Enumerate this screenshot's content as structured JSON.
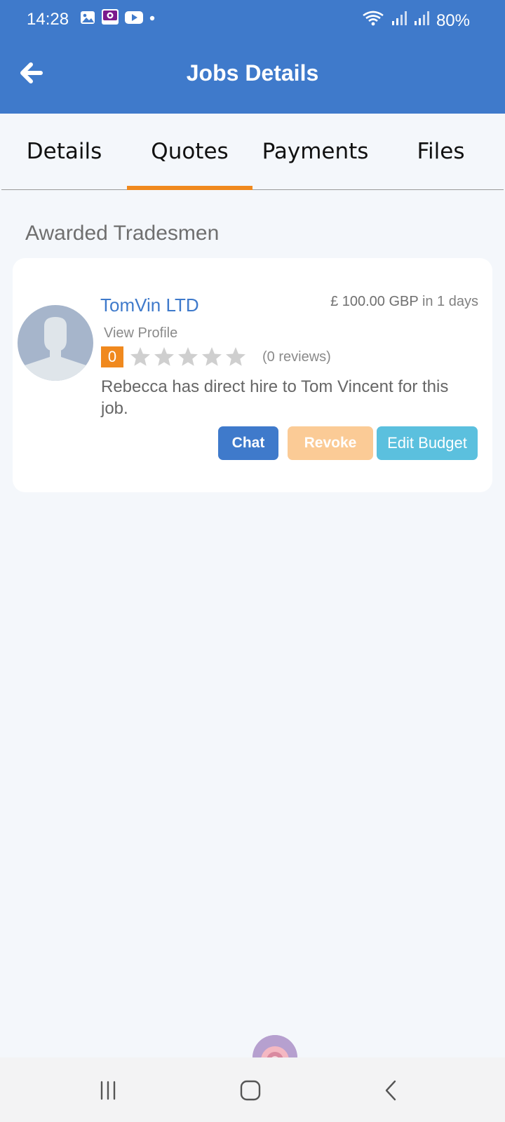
{
  "status_bar": {
    "time": "14:28",
    "battery": "80%"
  },
  "header": {
    "title": "Jobs Details"
  },
  "tabs": [
    {
      "label": "Details"
    },
    {
      "label": "Quotes",
      "active": true
    },
    {
      "label": "Payments"
    },
    {
      "label": "Files"
    }
  ],
  "section": {
    "title": "Awarded Tradesmen"
  },
  "tradesman": {
    "name": "TomVin LTD",
    "price": "£ 100.00 GBP",
    "duration": "in 1 days",
    "view_profile": "View Profile",
    "rating": "0",
    "stars_filled": 0,
    "stars_total": 5,
    "reviews": "(0 reviews)",
    "note": "Rebecca has direct hire to Tom Vincent for this job."
  },
  "buttons": {
    "chat": "Chat",
    "revoke": "Revoke",
    "edit_budget": "Edit Budget"
  },
  "colors": {
    "primary": "#3f7acb",
    "accent": "#f0891e",
    "revoke_disabled": "#fbcb96",
    "info": "#5bc0de",
    "background": "#f4f7fb"
  },
  "icons": {
    "back": "arrow-left-icon",
    "star": "star-icon",
    "nav_recents": "recents-icon",
    "nav_home": "home-icon",
    "nav_back": "chevron-left-icon"
  }
}
